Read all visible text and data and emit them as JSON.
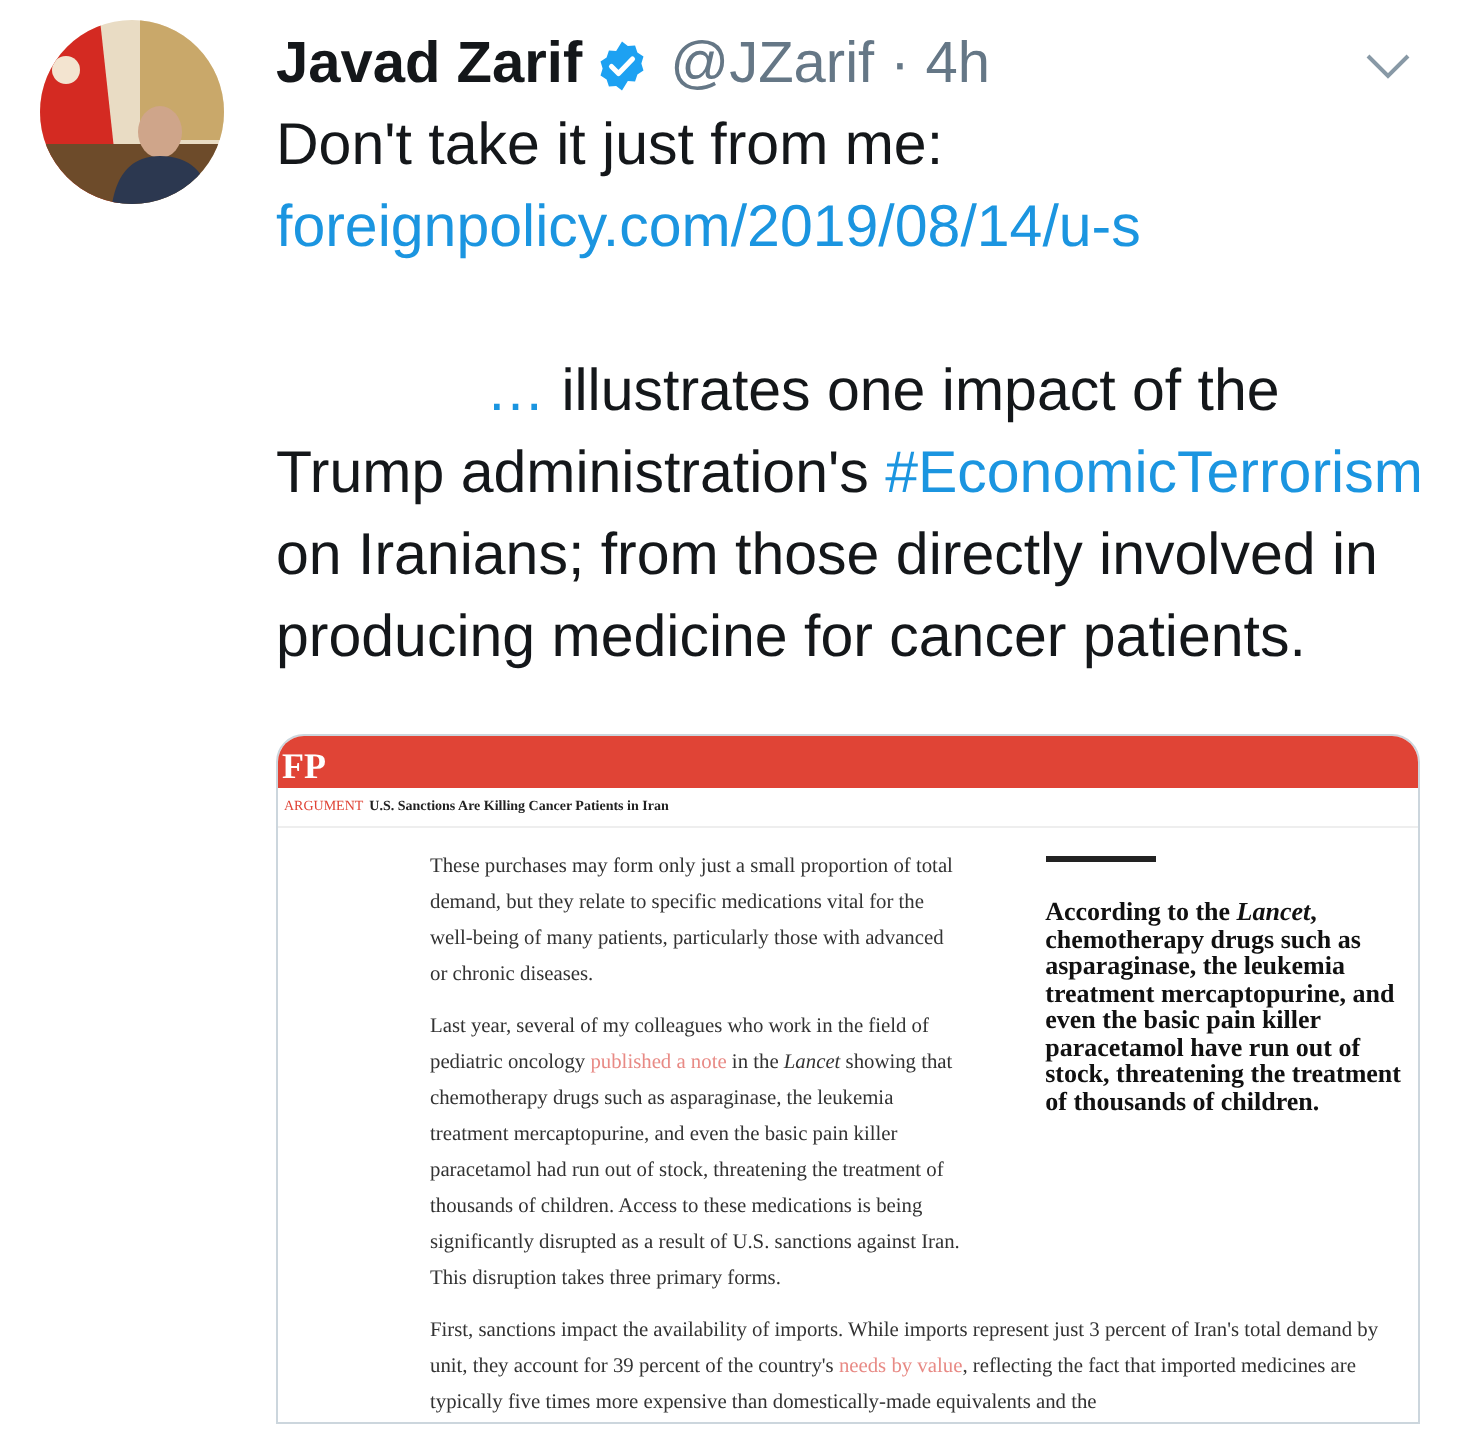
{
  "tweet": {
    "author": {
      "name": "Javad Zarif",
      "verified": true,
      "handle": "@JZarif",
      "separator": "·",
      "time": "4h"
    },
    "intro": "Don't take it just from me:",
    "link": "foreignpolicy.com/2019/08/14/u-s",
    "body": [
      {
        "kind": "ellipsis",
        "text": "…"
      },
      {
        "kind": "text",
        "text": " illustrates one impact of the Trump administration's "
      },
      {
        "kind": "hashtag",
        "text": "#EconomicTerrorism"
      },
      {
        "kind": "text",
        "text": " on Iranians; from those directly involved in producing medicine for cancer patients."
      }
    ]
  },
  "article": {
    "logo": "FP",
    "section": "ARGUMENT",
    "headline": "U.S. Sanctions Are Killing Cancer Patients in Iran",
    "column_paragraphs": [
      [
        {
          "kind": "text",
          "text": "These purchases may form only just a small proportion of total demand, but they relate to specific medications vital for the well-being of many patients, particularly those with advanced or chronic diseases."
        }
      ],
      [
        {
          "kind": "text",
          "text": "Last year, several of my colleagues who work in the field of pediatric oncology "
        },
        {
          "kind": "link",
          "text": "published a note"
        },
        {
          "kind": "text",
          "text": " in the *Lancet* showing that chemotherapy drugs such as asparaginase, the leukemia treatment mercaptopurine, and even the basic pain killer paracetamol had run out of stock, threatening the treatment of thousands of children. Access to these medications is being significantly disrupted as a result of U.S. sanctions against Iran. This disruption takes three primary forms."
        }
      ]
    ],
    "pull_quote": "According to the *Lancet*, chemotherapy drugs such as asparaginase, the leukemia treatment mercaptopurine, and even the basic pain killer paracetamol have run out of stock, threatening the treatment of thousands of children.",
    "wide_paragraph": [
      {
        "kind": "text",
        "text": "First, sanctions impact the availability of imports. While imports represent just 3 percent of Iran's total demand by unit, they account for 39 percent of the country's "
      },
      {
        "kind": "link",
        "text": "needs by value"
      },
      {
        "kind": "text",
        "text": ", reflecting the fact that imported medicines are typically five times more expensive than domestically-made equivalents and the"
      }
    ]
  }
}
